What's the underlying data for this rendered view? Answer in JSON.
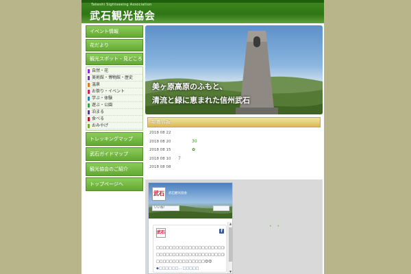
{
  "header": {
    "subtitle_en": "Takeshi Sightseeing Association",
    "title": "武石観光協会"
  },
  "sidebar": {
    "top_items": [
      {
        "label": "イベント情報"
      },
      {
        "label": "花だより"
      },
      {
        "label": "観光スポット・見どころ"
      }
    ],
    "sub_items": [
      {
        "label": "自然・花",
        "color": "#8a2be2"
      },
      {
        "label": "美術館・博物館・歴史",
        "color": "#6b3fa0"
      },
      {
        "label": "温泉",
        "color": "#e07a1f"
      },
      {
        "label": "お祭り・イベント",
        "color": "#d02060"
      },
      {
        "label": "学ぶ・体験",
        "color": "#2f7fbf"
      },
      {
        "label": "遊ぶ・公園",
        "color": "#3aa04a"
      },
      {
        "label": "泊まる",
        "color": "#5b3a9a"
      },
      {
        "label": "食べる",
        "color": "#c0152f"
      },
      {
        "label": "おみやげ",
        "color": "#7da82c"
      }
    ],
    "bottom_items": [
      {
        "label": "トレッキングマップ"
      },
      {
        "label": "武石ガイドマップ"
      },
      {
        "label": "観光協会のご紹介"
      },
      {
        "label": "トップページへ"
      }
    ]
  },
  "hero": {
    "line1": "美ヶ原高原のふもと、",
    "line2": "清流と緑に恵まれた信州武石"
  },
  "news": {
    "heading": "新着情報",
    "items": [
      {
        "date": "2018 08 22",
        "title": ""
      },
      {
        "date": "2018 08 20",
        "title": "30"
      },
      {
        "date": "2018 08 15",
        "title": "✿"
      },
      {
        "date": "2018 08 10",
        "title": "7"
      },
      {
        "date": "2018 08 08",
        "title": ""
      }
    ]
  },
  "facebook": {
    "logo_text": "武石",
    "page_name": "武石観光協会",
    "like_label": "いいね！",
    "f_icon": "f",
    "post_lines": [
      "□□□□□□□□□□□□□□□□□□□□□□□□□□□□□□😊",
      "□□□□□□□□□□□□□□□□□□□□□□□□□□□□□□□",
      "□□□□□□□□□□□□□□□😊😊",
      "◆□□□□□□… □□□□□"
    ],
    "side_dots": "• •"
  }
}
